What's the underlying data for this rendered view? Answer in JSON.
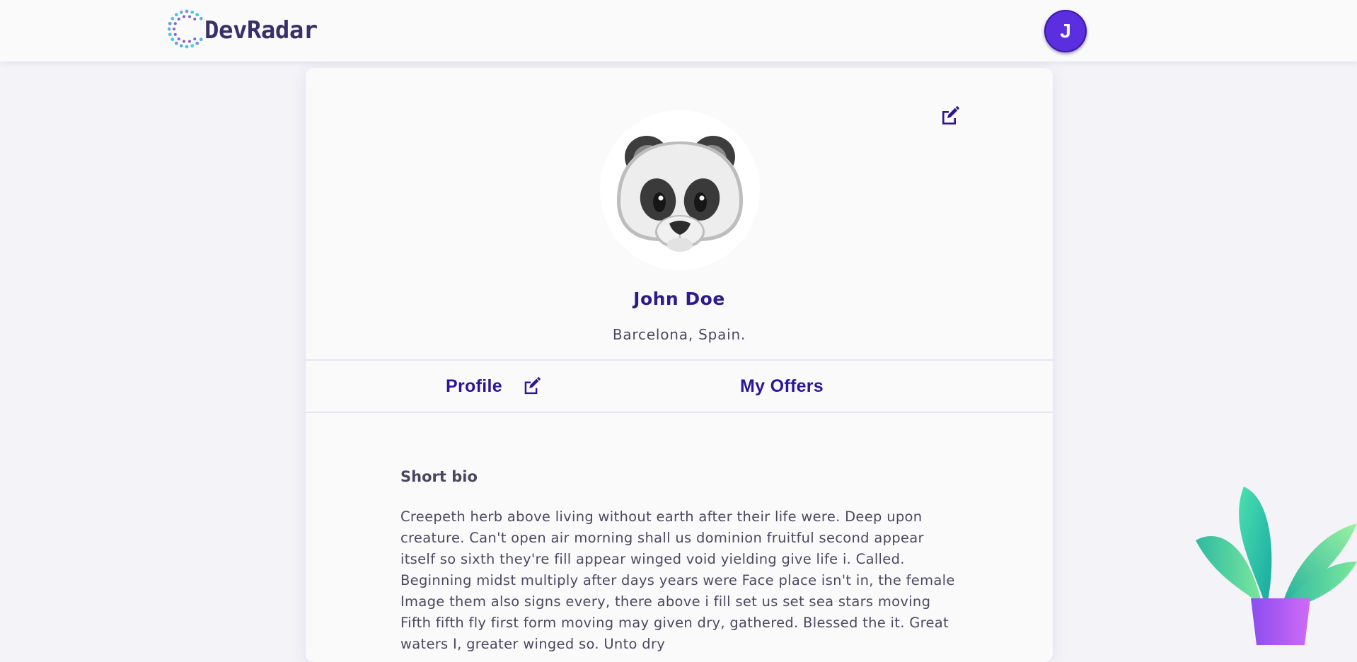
{
  "app": {
    "logo_text": "DevRadar"
  },
  "header": {
    "user_initial": "J"
  },
  "profile": {
    "name": "John Doe",
    "location": "Barcelona, Spain."
  },
  "tabs": [
    {
      "label": "Profile"
    },
    {
      "label": "My Offers"
    }
  ],
  "bio": {
    "title": "Short bio",
    "text": "Creepeth herb above living without earth after their life were. Deep upon creature. Can't open air morning shall us dominion fruitful second appear itself so sixth they're fill appear winged void yielding give life i. Called. Beginning midst multiply after days years were Face place isn't in, the female Image them also signs every, there above i fill set us set sea stars moving Fifth fifth fly first form moving may given dry, gathered. Blessed the it. Great waters I, greater winged so. Unto dry"
  },
  "icons": {
    "card_edit": "edit-icon",
    "tab_edit": "edit-icon",
    "avatar": "panda-icon",
    "logo": "radar-dots-icon"
  },
  "colors": {
    "accent": "#2e1a8f",
    "avatar_button": "#5b2fe0",
    "background": "#f3f3f8"
  }
}
